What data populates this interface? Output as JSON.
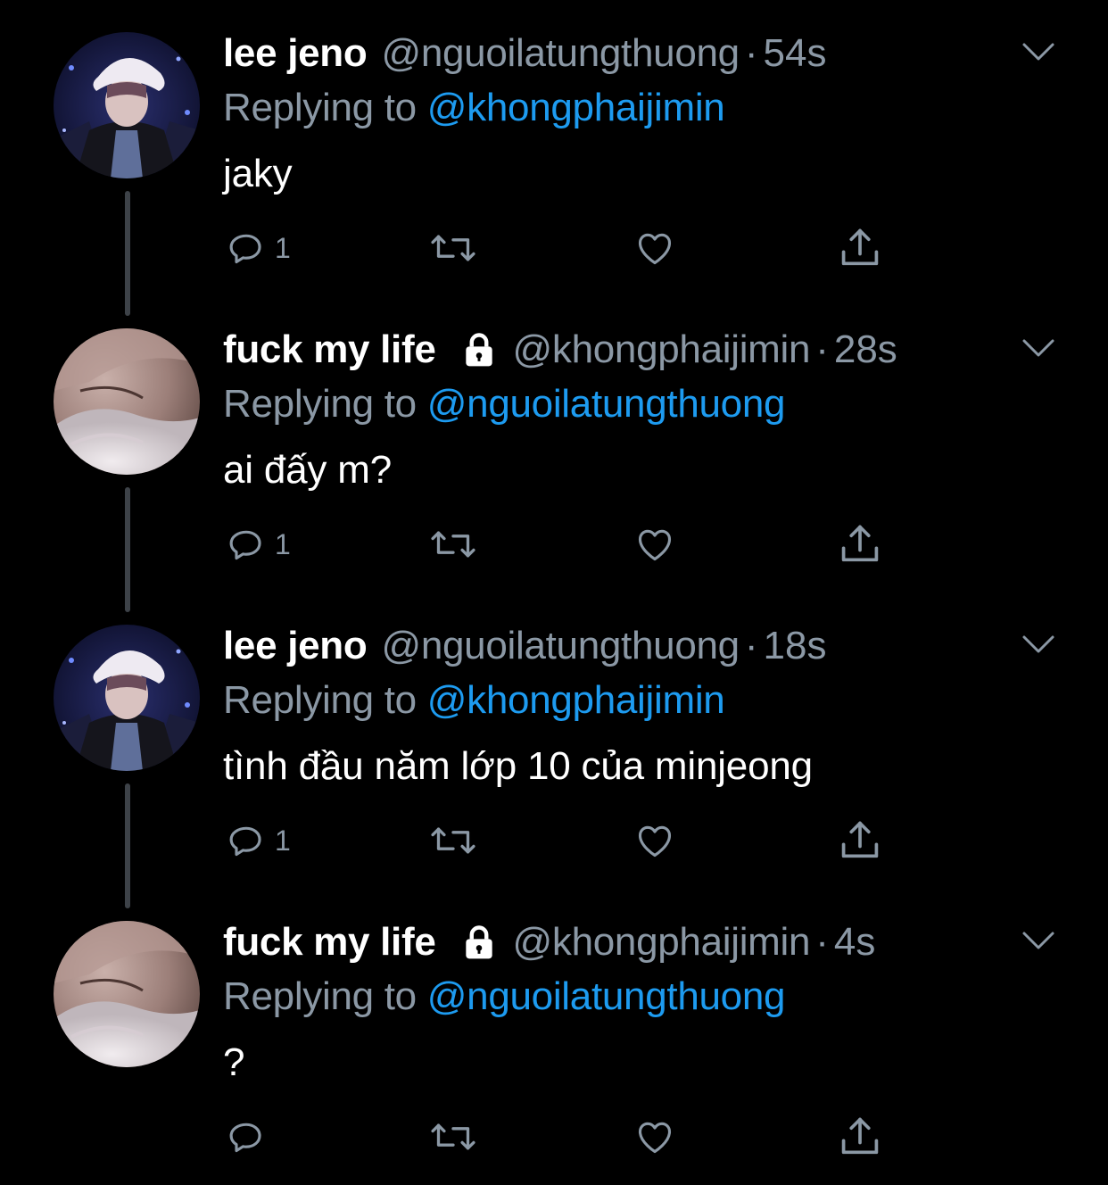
{
  "colors": {
    "background": "#000000",
    "primary_text": "#ffffff",
    "secondary_text": "#8b98a5",
    "link": "#1d9bf0",
    "thread_line": "#3d4248"
  },
  "tweets": [
    {
      "display_name": "lee jeno",
      "locked": false,
      "handle": "@nguoilatungthuong",
      "separator": "·",
      "time": "54s",
      "replying_prefix": "Replying to",
      "replying_to": "@khongphaijimin",
      "text": "jaky",
      "reply_count": "1",
      "avatar": "avatar-lee-jeno"
    },
    {
      "display_name": "fuck my life",
      "locked": true,
      "handle": "@khongphaijimin",
      "separator": "·",
      "time": "28s",
      "replying_prefix": "Replying to",
      "replying_to": "@nguoilatungthuong",
      "text": "ai đấy m?",
      "reply_count": "1",
      "avatar": "avatar-fuck-my-life"
    },
    {
      "display_name": "lee jeno",
      "locked": false,
      "handle": "@nguoilatungthuong",
      "separator": "·",
      "time": "18s",
      "replying_prefix": "Replying to",
      "replying_to": "@khongphaijimin",
      "text": "tình đầu năm lớp 10 của minjeong",
      "reply_count": "1",
      "avatar": "avatar-lee-jeno"
    },
    {
      "display_name": "fuck my life",
      "locked": true,
      "handle": "@khongphaijimin",
      "separator": "·",
      "time": "4s",
      "replying_prefix": "Replying to",
      "replying_to": "@nguoilatungthuong",
      "text": "?",
      "reply_count": "",
      "avatar": "avatar-fuck-my-life"
    }
  ],
  "icons": {
    "reply": "reply-icon",
    "retweet": "retweet-icon",
    "like": "heart-icon",
    "share": "share-icon",
    "lock": "lock-icon",
    "menu": "chevron-down-icon"
  }
}
